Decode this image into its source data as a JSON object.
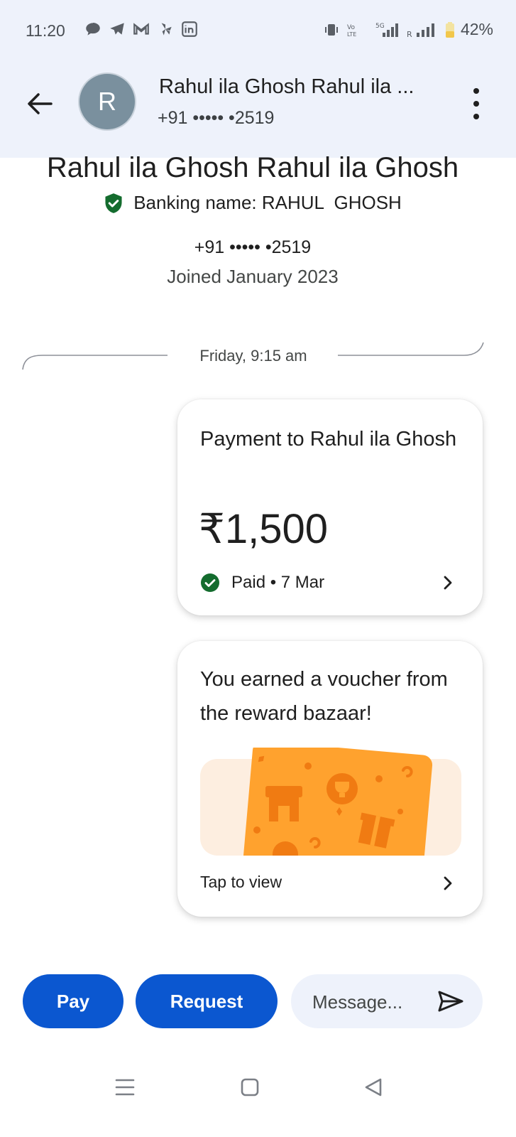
{
  "status_bar": {
    "time": "11:20",
    "battery": "42%",
    "network_label": "5G",
    "notification_icons": [
      "chat-icon",
      "telegram-icon",
      "gmail-icon",
      "pinwheel-icon",
      "linkedin-icon"
    ]
  },
  "header": {
    "avatar_letter": "R",
    "name": "Rahul ila Ghosh Rahul ila ...",
    "phone": "+91 ••••• •2519"
  },
  "profile": {
    "full_name": "Rahul ila Ghosh Rahul ila Ghosh",
    "banking_name": "Banking name: RAHUL  GHOSH",
    "phone": "+91 ••••• •2519",
    "joined": "Joined January 2023"
  },
  "conversation": {
    "date_label": "Friday, 9:15 am",
    "payment_card": {
      "title": "Payment to Rahul ila Ghosh",
      "amount": "₹1,500",
      "status": "Paid • 7 Mar"
    },
    "voucher_card": {
      "title": "You earned a voucher from the reward bazaar!",
      "cta": "Tap to view"
    }
  },
  "actions": {
    "pay_label": "Pay",
    "request_label": "Request",
    "message_placeholder": "Message..."
  },
  "colors": {
    "primary": "#0b57d0",
    "header_bg": "#eef2fb",
    "success": "#146c2e",
    "voucher_orange": "#ffa22e"
  }
}
